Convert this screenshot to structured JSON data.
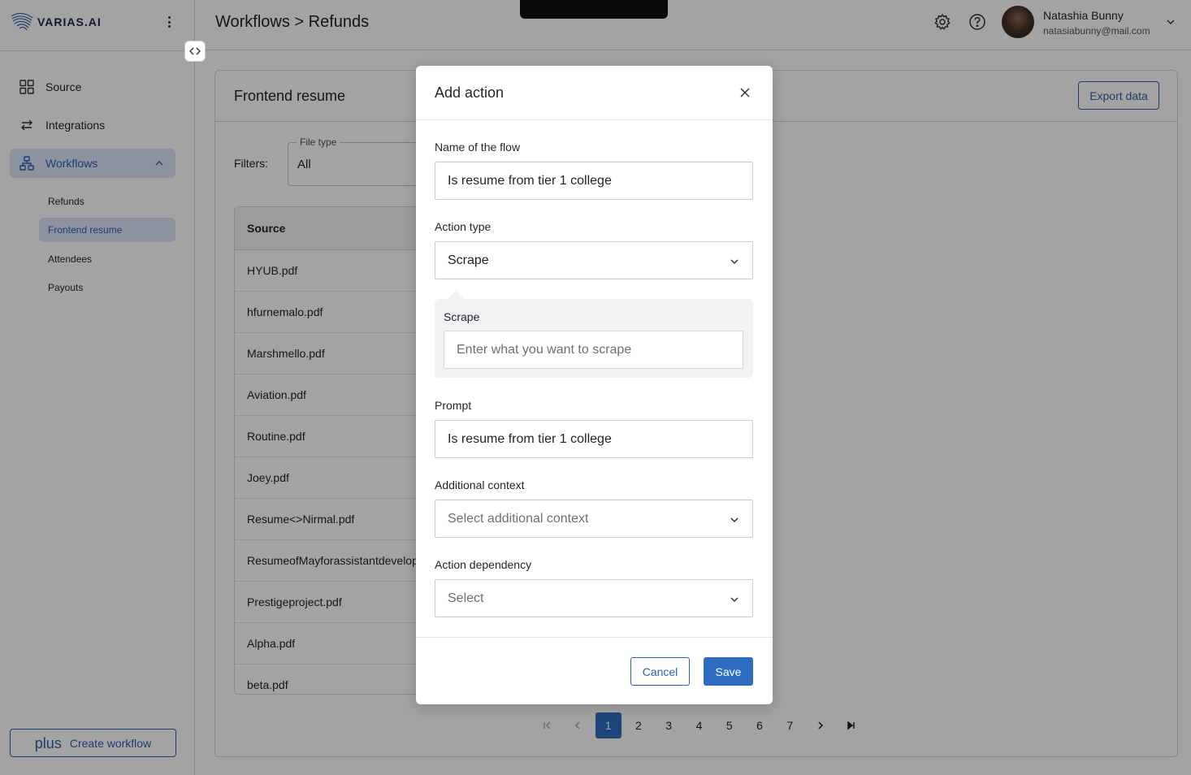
{
  "app": {
    "logo_text": "VARIAS.AI"
  },
  "sidebar": {
    "items": [
      {
        "label": "Source",
        "icon": "grid-icon"
      },
      {
        "label": "Integrations",
        "icon": "arrows-swap-icon"
      },
      {
        "label": "Workflows",
        "icon": "workflow-icon",
        "active": true
      }
    ],
    "workflows": [
      {
        "label": "Refunds"
      },
      {
        "label": "Frontend resume",
        "active": true
      },
      {
        "label": "Attendees"
      },
      {
        "label": "Payouts"
      }
    ],
    "create_button": {
      "icon": "plus",
      "label": "Create workflow"
    }
  },
  "header": {
    "breadcrumb": "Workflows > Refunds",
    "icons": [
      "gear-icon",
      "help-icon"
    ],
    "user": {
      "name": "Natashia Bunny",
      "email": "natasiabunny@mail.com"
    }
  },
  "main": {
    "title": "Frontend resume",
    "export_label": "Export data",
    "filters_label": "Filters:",
    "file_type": {
      "legend": "File type",
      "value": "All"
    },
    "table": {
      "header": "Source",
      "rows": [
        "HYUB.pdf",
        "hfurnemalo.pdf",
        "Marshmello.pdf",
        "Aviation.pdf",
        "Routine.pdf",
        "Joey.pdf",
        "Resume<>Nirmal.pdf",
        "ResumeofMayforassistantdevelop",
        "Prestigeproject.pdf",
        "Alpha.pdf",
        "beta.pdf"
      ]
    },
    "pagination": {
      "pages": [
        "1",
        "2",
        "3",
        "4",
        "5",
        "6",
        "7"
      ],
      "current": "1"
    }
  },
  "modal": {
    "title": "Add action",
    "fields": {
      "name": {
        "label": "Name of the flow",
        "value": "Is resume from tier 1 college"
      },
      "action_type": {
        "label": "Action type",
        "value": "Scrape"
      },
      "scrape": {
        "label": "Scrape",
        "placeholder": "Enter what you want to scrape"
      },
      "prompt": {
        "label": "Prompt",
        "value": "Is resume from tier 1 college"
      },
      "additional_context": {
        "label": "Additional context",
        "placeholder": "Select additional context"
      },
      "action_dependency": {
        "label": "Action dependency",
        "placeholder": "Select"
      }
    },
    "cancel_label": "Cancel",
    "save_label": "Save"
  },
  "colors": {
    "accent": "#2d6cc0",
    "active_bg": "#dde7f7",
    "overlay": "#000000"
  }
}
